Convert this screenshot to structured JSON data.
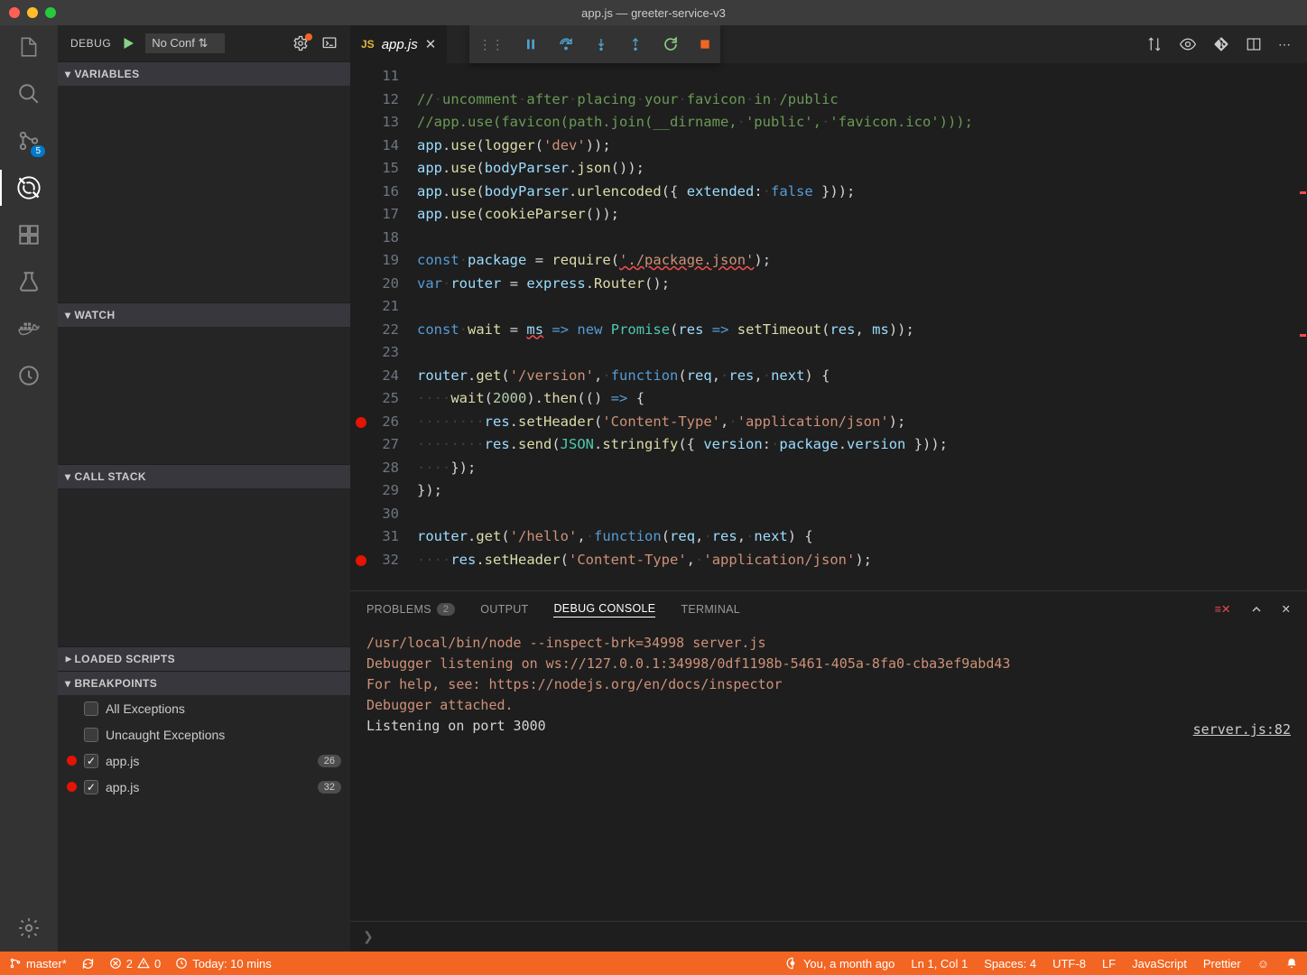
{
  "title": "app.js — greeter-service-v3",
  "activity": {
    "scm_badge": "5"
  },
  "sidebar": {
    "title": "DEBUG",
    "config": "No Conf",
    "sections": {
      "variables": "VARIABLES",
      "watch": "WATCH",
      "callstack": "CALL STACK",
      "loaded": "LOADED SCRIPTS",
      "breakpoints": "BREAKPOINTS"
    },
    "bp_items": [
      {
        "dot": false,
        "checked": false,
        "label": "All Exceptions",
        "count": ""
      },
      {
        "dot": false,
        "checked": false,
        "label": "Uncaught Exceptions",
        "count": ""
      },
      {
        "dot": true,
        "checked": true,
        "label": "app.js",
        "count": "26"
      },
      {
        "dot": true,
        "checked": true,
        "label": "app.js",
        "count": "32"
      }
    ]
  },
  "tab": {
    "icon": "JS",
    "name": "app.js"
  },
  "code": {
    "start": 11,
    "lines": [
      {
        "n": 11,
        "h": ""
      },
      {
        "n": 12,
        "h": "<span class='c-cmt'>//<span class='ws'>·</span>uncomment<span class='ws'>·</span>after<span class='ws'>·</span>placing<span class='ws'>·</span>your<span class='ws'>·</span>favicon<span class='ws'>·</span>in<span class='ws'>·</span>/public</span>"
      },
      {
        "n": 13,
        "h": "<span class='c-cmt'>//app.use(favicon(path.join(__dirname,<span class='ws'>·</span>'public',<span class='ws'>·</span>'favicon.ico')));</span>"
      },
      {
        "n": 14,
        "h": "<span class='c-var'>app</span><span class='c-p'>.</span><span class='c-fn'>use</span><span class='c-p'>(</span><span class='c-fn'>logger</span><span class='c-p'>(</span><span class='c-str'>'dev'</span><span class='c-p'>));</span>"
      },
      {
        "n": 15,
        "h": "<span class='c-var'>app</span><span class='c-p'>.</span><span class='c-fn'>use</span><span class='c-p'>(</span><span class='c-var'>bodyParser</span><span class='c-p'>.</span><span class='c-fn'>json</span><span class='c-p'>());</span>"
      },
      {
        "n": 16,
        "h": "<span class='c-var'>app</span><span class='c-p'>.</span><span class='c-fn'>use</span><span class='c-p'>(</span><span class='c-var'>bodyParser</span><span class='c-p'>.</span><span class='c-fn'>urlencoded</span><span class='c-p'>({ </span><span class='c-var'>extended</span><span class='c-p'>:</span><span class='ws'>·</span><span class='c-kw'>false</span><span class='c-p'> }));</span>"
      },
      {
        "n": 17,
        "h": "<span class='c-var'>app</span><span class='c-p'>.</span><span class='c-fn'>use</span><span class='c-p'>(</span><span class='c-fn'>cookieParser</span><span class='c-p'>());</span>"
      },
      {
        "n": 18,
        "h": ""
      },
      {
        "n": 19,
        "h": "<span class='c-kw'>const</span><span class='ws'>·</span><span class='c-var'>package</span> <span class='c-p'>=</span> <span class='c-fn'>require</span><span class='c-p'>(</span><span class='c-str c-err'>'./package.json'</span><span class='c-p'>);</span>"
      },
      {
        "n": 20,
        "h": "<span class='c-kw'>var</span><span class='ws'>·</span><span class='c-var'>router</span> <span class='c-p'>=</span> <span class='c-var'>express</span><span class='c-p'>.</span><span class='c-fn'>Router</span><span class='c-p'>();</span>"
      },
      {
        "n": 21,
        "h": ""
      },
      {
        "n": 22,
        "h": "<span class='c-kw'>const</span><span class='ws'>·</span><span class='c-fn'>wait</span> <span class='c-p'>=</span> <span class='c-var c-err'>ms</span> <span class='c-kw'>=&gt;</span> <span class='c-kw'>new</span> <span class='c-cls'>Promise</span><span class='c-p'>(</span><span class='c-var'>res</span> <span class='c-kw'>=&gt;</span> <span class='c-fn'>setTimeout</span><span class='c-p'>(</span><span class='c-var'>res</span><span class='c-p'>,</span> <span class='c-var'>ms</span><span class='c-p'>));</span>"
      },
      {
        "n": 23,
        "h": ""
      },
      {
        "n": 24,
        "h": "<span class='c-var'>router</span><span class='c-p'>.</span><span class='c-fn'>get</span><span class='c-p'>(</span><span class='c-str'>'/version'</span><span class='c-p'>,</span><span class='ws'>·</span><span class='c-kw'>function</span><span class='c-p'>(</span><span class='c-var'>req</span><span class='c-p'>,</span><span class='ws'>·</span><span class='c-var'>res</span><span class='c-p'>,</span><span class='ws'>·</span><span class='c-var'>next</span><span class='c-p'>) {</span>"
      },
      {
        "n": 25,
        "h": "<span class='ws'>····</span><span class='c-fn'>wait</span><span class='c-p'>(</span><span class='c-num'>2000</span><span class='c-p'>).</span><span class='c-fn'>then</span><span class='c-p'>(()</span> <span class='c-kw'>=&gt;</span> <span class='c-p'>{</span>"
      },
      {
        "n": 26,
        "bp": true,
        "h": "<span class='ws'>········</span><span class='c-var'>res</span><span class='c-p'>.</span><span class='c-fn'>setHeader</span><span class='c-p'>(</span><span class='c-str'>'Content-Type'</span><span class='c-p'>,</span><span class='ws'>·</span><span class='c-str'>'application/json'</span><span class='c-p'>);</span>"
      },
      {
        "n": 27,
        "h": "<span class='ws'>········</span><span class='c-var'>res</span><span class='c-p'>.</span><span class='c-fn'>send</span><span class='c-p'>(</span><span class='c-cls'>JSON</span><span class='c-p'>.</span><span class='c-fn'>stringify</span><span class='c-p'>({ </span><span class='c-var'>version</span><span class='c-p'>:</span><span class='ws'>·</span><span class='c-var'>package</span><span class='c-p'>.</span><span class='c-var'>version</span><span class='c-p'> }));</span>"
      },
      {
        "n": 28,
        "h": "<span class='ws'>····</span><span class='c-p'>});</span>"
      },
      {
        "n": 29,
        "h": "<span class='c-p'>});</span>"
      },
      {
        "n": 30,
        "h": ""
      },
      {
        "n": 31,
        "h": "<span class='c-var'>router</span><span class='c-p'>.</span><span class='c-fn'>get</span><span class='c-p'>(</span><span class='c-str'>'/hello'</span><span class='c-p'>,</span><span class='ws'>·</span><span class='c-kw'>function</span><span class='c-p'>(</span><span class='c-var'>req</span><span class='c-p'>,</span><span class='ws'>·</span><span class='c-var'>res</span><span class='c-p'>,</span><span class='ws'>·</span><span class='c-var'>next</span><span class='c-p'>) {</span>"
      },
      {
        "n": 32,
        "bp": true,
        "h": "<span class='ws'>····</span><span class='c-var'>res</span><span class='c-p'>.</span><span class='c-fn'>setHeader</span><span class='c-p'>(</span><span class='c-str'>'Content-Type'</span><span class='c-p'>,</span><span class='ws'>·</span><span class='c-str'>'application/json'</span><span class='c-p'>);</span>"
      }
    ]
  },
  "panel": {
    "tabs": {
      "problems": "PROBLEMS",
      "problems_cnt": "2",
      "output": "OUTPUT",
      "debug": "DEBUG CONSOLE",
      "terminal": "TERMINAL"
    },
    "console": [
      {
        "c": "#ce9178",
        "t": "/usr/local/bin/node --inspect-brk=34998 server.js"
      },
      {
        "c": "#ce9178",
        "t": "Debugger listening on ws://127.0.0.1:34998/0df1198b-5461-405a-8fa0-cba3ef9abd43"
      },
      {
        "c": "#ce9178",
        "t": "For help, see: https://nodejs.org/en/docs/inspector"
      },
      {
        "c": "#ce9178",
        "t": "Debugger attached."
      },
      {
        "c": "#d4d4d4",
        "t": "Listening on port 3000"
      }
    ],
    "source_link": "server.js:82"
  },
  "status": {
    "branch": "master*",
    "errors": "2",
    "warnings": "0",
    "clock": "Today: 10 mins",
    "blame": "You, a month ago",
    "pos": "Ln 1, Col 1",
    "spaces": "Spaces: 4",
    "enc": "UTF-8",
    "eol": "LF",
    "lang": "JavaScript",
    "prettier": "Prettier"
  }
}
